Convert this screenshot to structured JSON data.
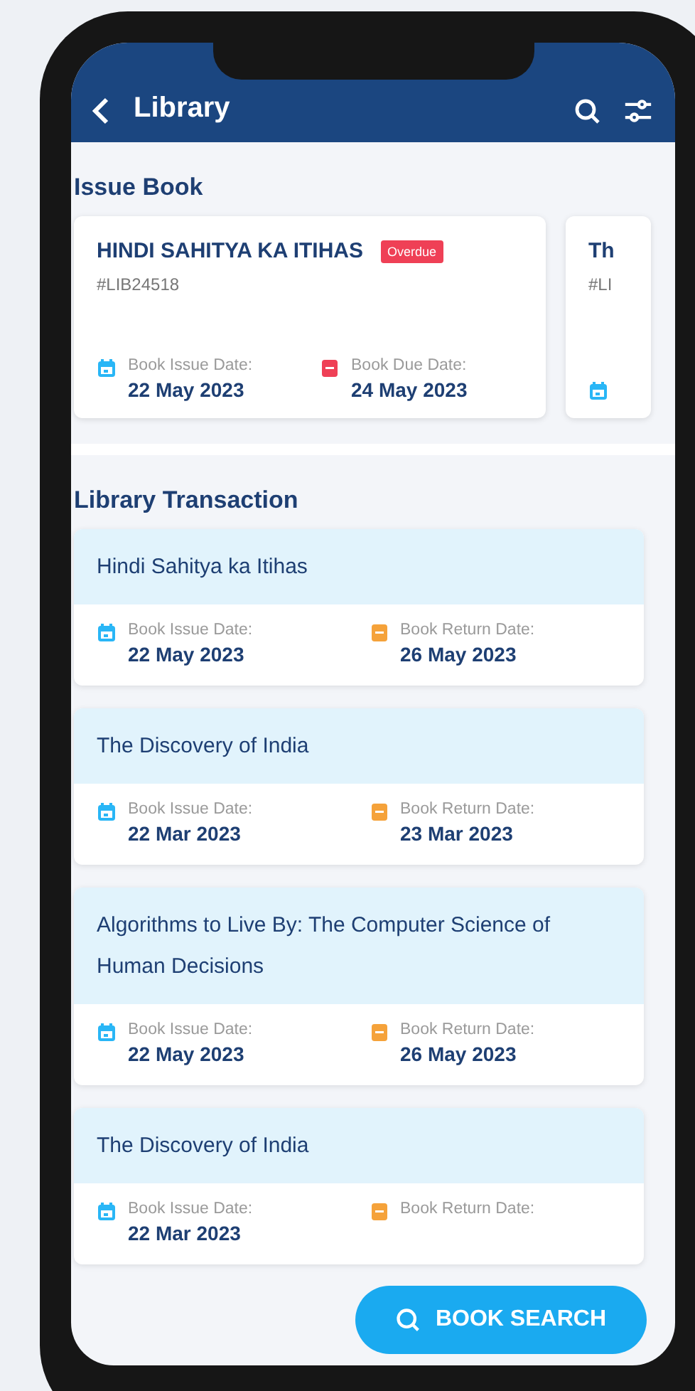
{
  "header": {
    "title": "Library"
  },
  "issue_section": {
    "title": "Issue Book",
    "cards": [
      {
        "title": "HINDI SAHITYA KA ITIHAS",
        "badge": "Overdue",
        "id": "#LIB24518",
        "issue_label": "Book Issue Date:",
        "issue_date": "22 May 2023",
        "due_label": "Book Due Date:",
        "due_date": "24 May 2023"
      },
      {
        "title": "Th",
        "id": "#LI"
      }
    ]
  },
  "transactions": {
    "title": "Library Transaction",
    "items": [
      {
        "title": "Hindi Sahitya ka Itihas",
        "issue_label": "Book Issue Date:",
        "issue_date": "22 May 2023",
        "return_label": "Book Return Date:",
        "return_date": "26 May 2023"
      },
      {
        "title": "The Discovery of India",
        "issue_label": "Book Issue Date:",
        "issue_date": "22 Mar 2023",
        "return_label": "Book Return Date:",
        "return_date": "23 Mar 2023"
      },
      {
        "title": "Algorithms to Live By: The Computer Science of Human Decisions",
        "issue_label": "Book Issue Date:",
        "issue_date": "22 May 2023",
        "return_label": "Book Return Date:",
        "return_date": "26 May 2023"
      },
      {
        "title": "The Discovery of India",
        "issue_label": "Book Issue Date:",
        "issue_date": "22 Mar 2023",
        "return_label": "Book Return Date:"
      }
    ]
  },
  "fab": {
    "label": "BOOK SEARCH"
  }
}
